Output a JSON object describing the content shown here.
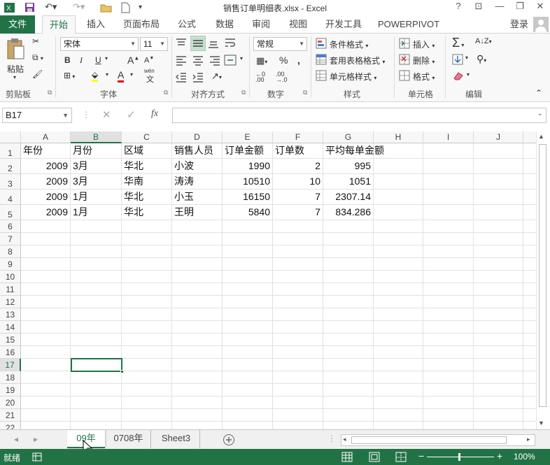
{
  "window": {
    "title": "销售订单明细表.xlsx - Excel",
    "help": "?",
    "minimize": "—",
    "close": "✕"
  },
  "account": {
    "login": "登录"
  },
  "tabs": [
    "文件",
    "开始",
    "插入",
    "页面布局",
    "公式",
    "数据",
    "审阅",
    "视图",
    "开发工具",
    "POWERPIVOT"
  ],
  "ribbon": {
    "clipboard": {
      "paste": "粘贴",
      "label": "剪贴板"
    },
    "font": {
      "name": "宋体",
      "size": "11",
      "bold": "B",
      "italic": "I",
      "underline": "U",
      "grow": "A",
      "shrink": "A",
      "wen": "wén",
      "label": "字体"
    },
    "alignment": {
      "label": "对齐方式"
    },
    "number": {
      "format": "常规",
      "percent": "%",
      "label": "数字"
    },
    "styles": {
      "conditional": "条件格式",
      "table": "套用表格格式",
      "cell": "单元格样式",
      "label": "样式"
    },
    "cells": {
      "insert": "插入",
      "delete": "删除",
      "format": "格式",
      "label": "单元格"
    },
    "editing": {
      "label": "编辑"
    }
  },
  "formula_bar": {
    "name_box": "B17",
    "fx": "fx",
    "content": ""
  },
  "columns": [
    "A",
    "B",
    "C",
    "D",
    "E",
    "F",
    "G",
    "H",
    "I",
    "J"
  ],
  "rows": [
    "1",
    "2",
    "3",
    "4",
    "5",
    "6",
    "7",
    "8",
    "9",
    "10",
    "11",
    "12",
    "13",
    "14",
    "15",
    "16",
    "17",
    "18",
    "19",
    "20",
    "21",
    "22"
  ],
  "table": {
    "header": [
      "年份",
      "月份",
      "区域",
      "销售人员",
      "订单金额",
      "订单数",
      "平均每单金额"
    ],
    "data": [
      [
        "2009",
        "3月",
        "华北",
        "小波",
        "1990",
        "2",
        "995"
      ],
      [
        "2009",
        "3月",
        "华南",
        "涛涛",
        "10510",
        "10",
        "1051"
      ],
      [
        "2009",
        "1月",
        "华北",
        "小玉",
        "16150",
        "7",
        "2307.14"
      ],
      [
        "2009",
        "1月",
        "华北",
        "王明",
        "5840",
        "7",
        "834.286"
      ]
    ]
  },
  "sheets": [
    "09年",
    "0708年",
    "Sheet3"
  ],
  "status": {
    "ready": "就绪",
    "zoom": "100%"
  },
  "colors": {
    "accent": "#217346"
  }
}
